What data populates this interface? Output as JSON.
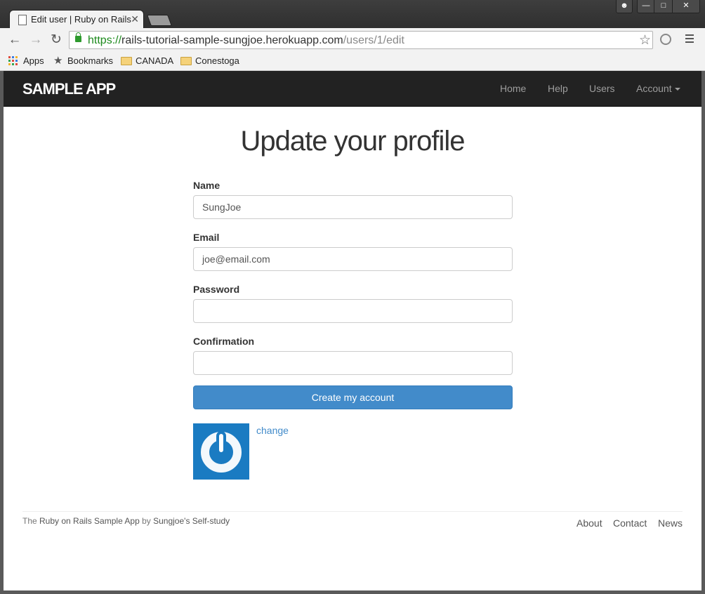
{
  "browser": {
    "tab_title": "Edit user | Ruby on Rails",
    "url_proto": "https://",
    "url_host": "rails-tutorial-sample-sungjoe.herokuapp.com",
    "url_path": "/users/1/edit"
  },
  "bookmarks": {
    "apps": "Apps",
    "bookmarks": "Bookmarks",
    "canada": "CANADA",
    "conestoga": "Conestoga"
  },
  "navbar": {
    "brand": "SAMPLE APP",
    "home": "Home",
    "help": "Help",
    "users": "Users",
    "account": "Account"
  },
  "form": {
    "heading": "Update your profile",
    "name_label": "Name",
    "name_value": "SungJoe",
    "email_label": "Email",
    "email_value": "joe@email.com",
    "password_label": "Password",
    "password_value": "",
    "confirmation_label": "Confirmation",
    "confirmation_value": "",
    "submit_label": "Create my account",
    "change_link": "change"
  },
  "footer": {
    "text_prefix": "The ",
    "text_link1": "Ruby on Rails Sample App",
    "text_mid": " by ",
    "text_link2": "Sungjoe's Self-study",
    "about": "About",
    "contact": "Contact",
    "news": "News"
  },
  "colors": {
    "navbar_bg": "#222222",
    "primary_button": "#428bca",
    "gravatar_bg": "#1a7bc2"
  }
}
